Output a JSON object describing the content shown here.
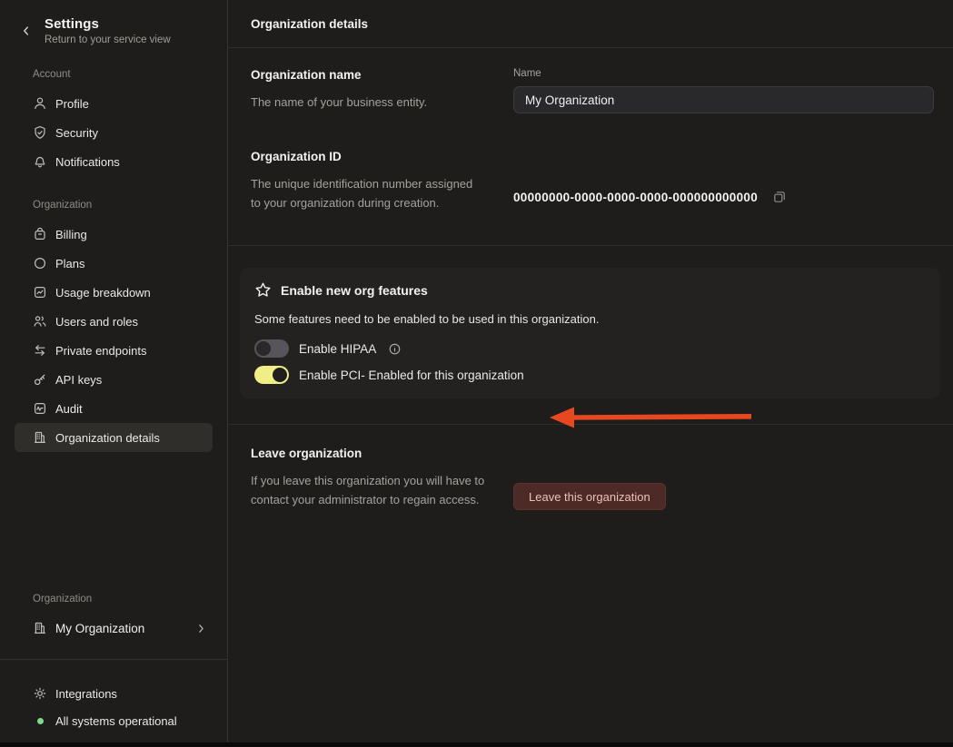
{
  "colors": {
    "toggle_on": "#f1ee85",
    "toggle_off": "#57555b",
    "arrow": "#e8481f",
    "danger_button_bg": "#4e2a26",
    "danger_button_text": "#eec2ba",
    "status_green": "#7ed88a"
  },
  "sidebar": {
    "title": "Settings",
    "subtitle": "Return to your service view",
    "sections": [
      {
        "label": "Account",
        "items": [
          {
            "label": "Profile",
            "icon": "user-icon"
          },
          {
            "label": "Security",
            "icon": "shield-check-icon"
          },
          {
            "label": "Notifications",
            "icon": "bell-icon"
          }
        ]
      },
      {
        "label": "Organization",
        "items": [
          {
            "label": "Billing",
            "icon": "billing-icon"
          },
          {
            "label": "Plans",
            "icon": "circle-icon"
          },
          {
            "label": "Usage breakdown",
            "icon": "usage-chart-icon"
          },
          {
            "label": "Users and roles",
            "icon": "users-icon"
          },
          {
            "label": "Private endpoints",
            "icon": "arrows-swap-icon"
          },
          {
            "label": "API keys",
            "icon": "key-icon"
          },
          {
            "label": "Audit",
            "icon": "audit-pulse-icon"
          },
          {
            "label": "Organization details",
            "icon": "building-icon",
            "selected": true
          }
        ]
      }
    ],
    "org_switcher": {
      "label": "Organization",
      "value": "My Organization",
      "icon": "building-icon"
    },
    "footer": {
      "integrations_label": "Integrations",
      "status_label": "All systems operational"
    }
  },
  "main": {
    "header_title": "Organization details",
    "org_name_section": {
      "title": "Organization name",
      "description": "The name of your business entity.",
      "field_label": "Name",
      "field_value": "My Organization"
    },
    "org_id_section": {
      "title": "Organization ID",
      "description": "The unique identification number assigned to your organization during creation.",
      "value": "00000000-0000-0000-0000-000000000000"
    },
    "features_card": {
      "title": "Enable new org features",
      "description": "Some features need to be enabled to be used in this organization.",
      "toggles": [
        {
          "label": "Enable HIPAA",
          "state": "off"
        },
        {
          "label": "Enable PCI- Enabled for this organization",
          "state": "on"
        }
      ],
      "annotation": "red arrow pointing at PCI toggle"
    },
    "leave_section": {
      "title": "Leave organization",
      "description": "If you leave this organization you will have to contact your administrator to regain access.",
      "button_label": "Leave this organization"
    }
  }
}
